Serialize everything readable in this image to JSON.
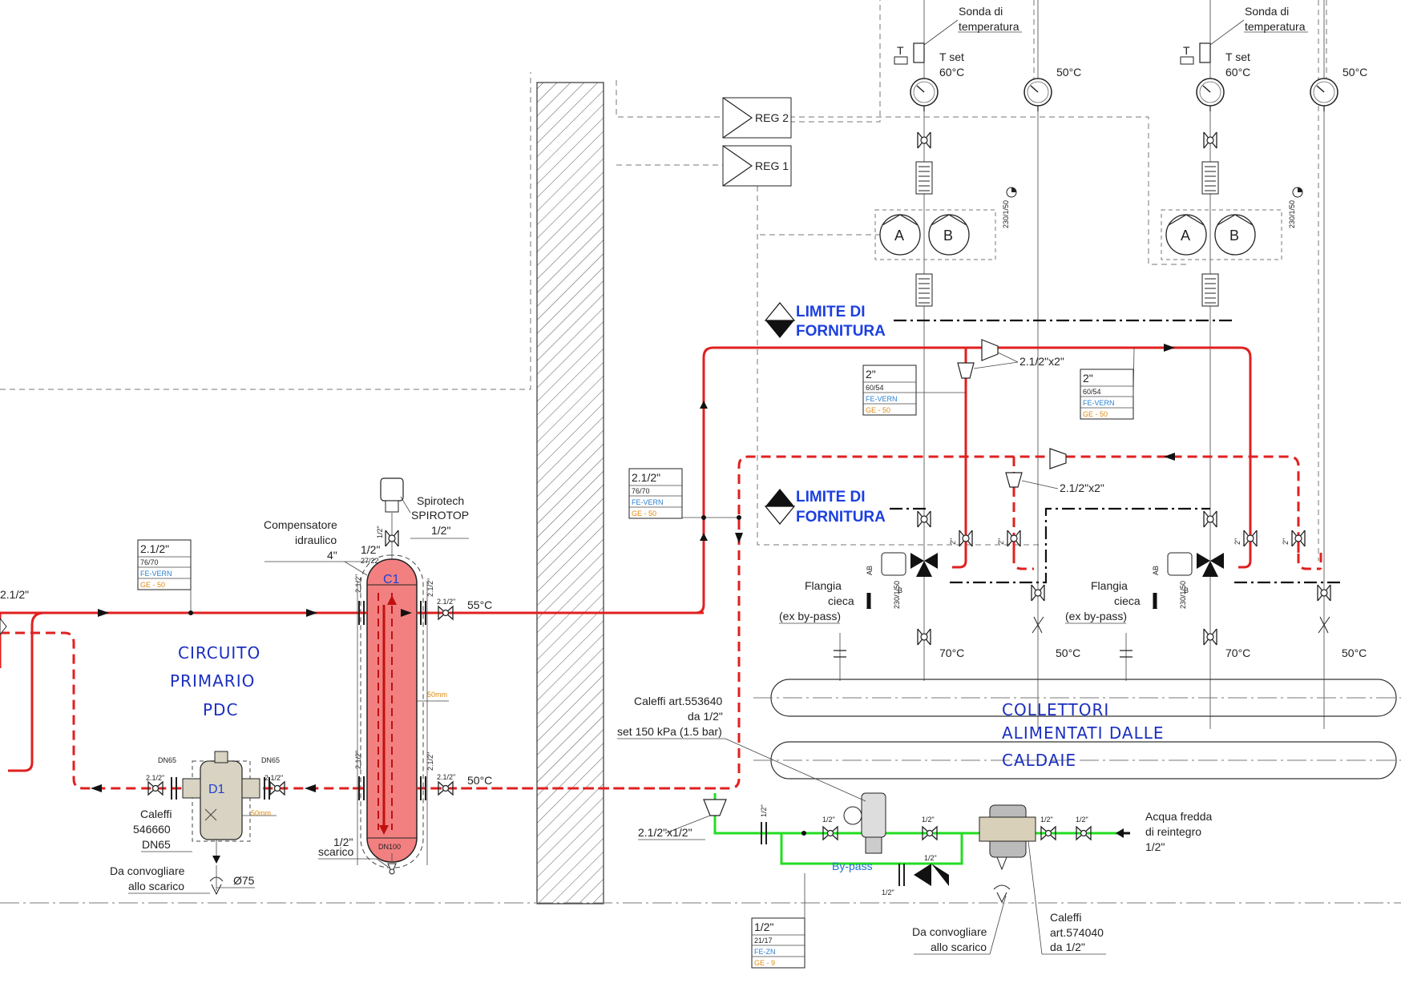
{
  "sensors": [
    {
      "label_1": "Sonda di",
      "label_2": "temperatura",
      "tset": "T set",
      "tval": "60°C",
      "ret": "50°C",
      "t": "T"
    },
    {
      "label_1": "Sonda di",
      "label_2": "temperatura",
      "tset": "T set",
      "tval": "60°C",
      "ret": "50°C",
      "t": "T"
    }
  ],
  "regulators": {
    "reg2": "REG 2",
    "reg1": "REG 1"
  },
  "pumps": [
    {
      "a": "A",
      "b": "B",
      "elec": "230/1/50"
    },
    {
      "a": "A",
      "b": "B",
      "elec": "230/1/50"
    }
  ],
  "supply_limit": {
    "line1": "LIMITE DI",
    "line2": "FORNITURA"
  },
  "supply_limit_2": {
    "line1": "LIMITE DI",
    "line2": "FORNITURA"
  },
  "pipe_tags": {
    "upper_left": {
      "size": "2\"",
      "dim": "60/54",
      "mat": "FE-VERN",
      "ins": "GE - 50"
    },
    "upper_right": {
      "size": "2\"",
      "dim": "60/54",
      "mat": "FE-VERN",
      "ins": "GE - 50"
    },
    "riser": {
      "size": "2.1/2\"",
      "dim": "76/70",
      "mat": "FE-VERN",
      "ins": "GE - 50"
    },
    "primary": {
      "size": "2.1/2\"",
      "dim": "76/70",
      "mat": "FE-VERN",
      "ins": "GE - 50"
    },
    "fill": {
      "size": "1/2\"",
      "dim": "21/17",
      "mat": "FE-ZN",
      "ins": "GE - 9"
    }
  },
  "reducers": {
    "top": "2.1/2\"x2\"",
    "mid": "2.1/2\"x2\"",
    "fill": "2.1/2\"x1/2\""
  },
  "mixing": {
    "flange_1": "Flangia",
    "flange_2": "cieca",
    "flange_3": "(ex by-pass)",
    "supply": "70°C",
    "return": "50°C",
    "ab": "AB",
    "a": "A",
    "b": "B",
    "size": "2\""
  },
  "spirotop": {
    "name_1": "Spirotech",
    "name_2": "SPIROTOP",
    "size": "1/2\""
  },
  "compensator": {
    "label_1": "Compensatore",
    "label_2": "idraulico",
    "size": "4\"",
    "code": "C1",
    "pipe": "1/2\"",
    "pipe_dim": "27/22",
    "dn": "DN100",
    "drain_1": "1/2\"",
    "drain_2": "scarico",
    "dim_mark": "50mm"
  },
  "temps": {
    "hot": "55°C",
    "cold": "50°C"
  },
  "primary_size_left": "2.1/2\"",
  "handwritten": {
    "c1": "CIRCUITO",
    "c2": "PRIMARIO",
    "c3": "PDC",
    "m1": "COLLETTORI",
    "m2": "ALIMENTATI DALLE",
    "m3": "CALDAIE"
  },
  "dirt_sep": {
    "code": "D1",
    "brand": "Caleffi",
    "art": "546660",
    "dn": "DN65",
    "dn_l": "DN65",
    "dn_r": "DN65",
    "size": "2.1/2\"",
    "dim_mark": "50mm",
    "drain_1": "Da convogliare",
    "drain_2": "allo scarico",
    "diam": "Ø75"
  },
  "fill_group": {
    "valve_1": "Caleffi art.553640",
    "valve_2": "da 1/2\"",
    "valve_3": "set 150 kPa (1.5 bar)",
    "bypass": "By-pass",
    "half": "1/2\"",
    "cold_1": "Acqua fredda",
    "cold_2": "di reintegro",
    "cold_3": "1/2\"",
    "disc_1": "Caleffi",
    "disc_2": "art.574040",
    "disc_3": "da 1/2\"",
    "drain_1": "Da convogliare",
    "drain_2": "allo scarico"
  }
}
